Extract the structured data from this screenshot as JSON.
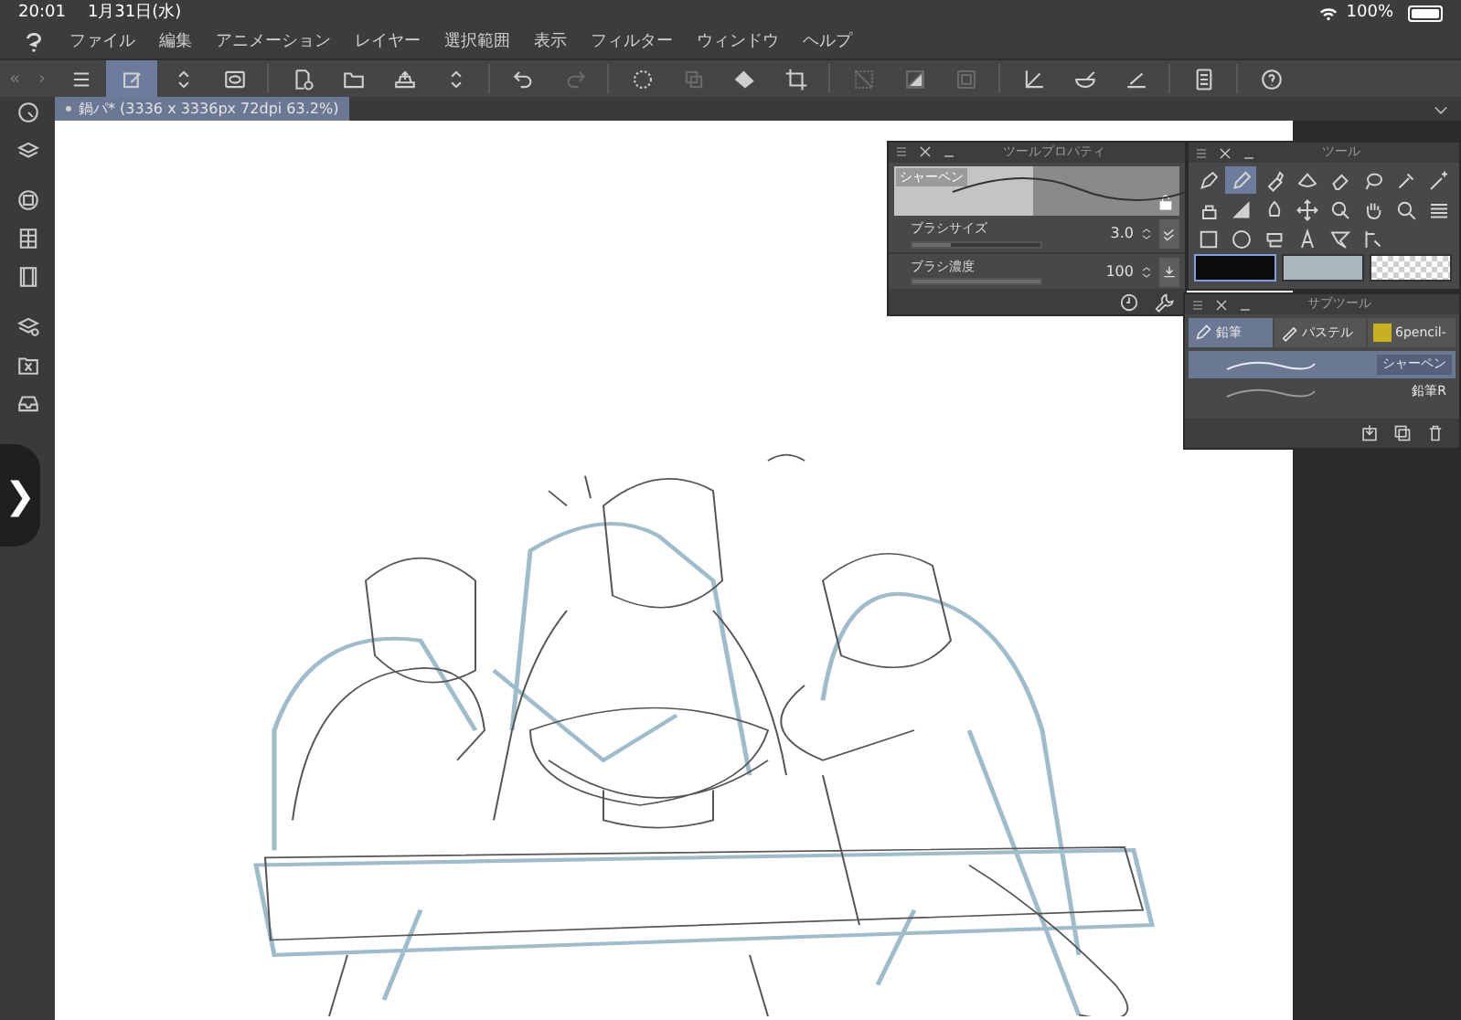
{
  "status_bar": {
    "time": "20:01",
    "date": "1月31日(水)",
    "battery": "100%"
  },
  "menu": {
    "items": [
      "ファイル",
      "編集",
      "アニメーション",
      "レイヤー",
      "選択範囲",
      "表示",
      "フィルター",
      "ウィンドウ",
      "ヘルプ"
    ]
  },
  "toolbar": {
    "nav": [
      "«",
      "›"
    ],
    "groups": [
      [
        {
          "selected": false,
          "disabled": false
        },
        {
          "selected": true,
          "disabled": false
        },
        {
          "selected": false,
          "disabled": false
        },
        {
          "selected": false,
          "disabled": false
        }
      ],
      [
        {
          "selected": false,
          "disabled": false
        },
        {
          "selected": false,
          "disabled": false
        },
        {
          "selected": false,
          "disabled": false
        },
        {
          "selected": false,
          "disabled": false
        }
      ],
      [
        {
          "selected": false,
          "disabled": false
        },
        {
          "selected": false,
          "disabled": true
        }
      ],
      [
        {
          "selected": false,
          "disabled": false
        },
        {
          "selected": false,
          "disabled": true
        },
        {
          "selected": false,
          "disabled": false
        },
        {
          "selected": false,
          "disabled": false
        }
      ],
      [
        {
          "selected": false,
          "disabled": true
        },
        {
          "selected": false,
          "disabled": true
        },
        {
          "selected": false,
          "disabled": true
        }
      ],
      [
        {
          "selected": false,
          "disabled": false
        },
        {
          "selected": false,
          "disabled": false
        },
        {
          "selected": false,
          "disabled": false
        }
      ],
      [
        {
          "selected": false,
          "disabled": false
        }
      ],
      [
        {
          "selected": false,
          "disabled": false
        }
      ]
    ]
  },
  "document_tab": {
    "title": "鍋パ* (3336 x 3336px 72dpi 63.2%)",
    "selected": true
  },
  "sidebar": {
    "handle": "❯"
  },
  "tool_property": {
    "title": "ツールプロパティ",
    "brush_name": "シャーペン",
    "rows": [
      {
        "label": "ブラシサイズ",
        "value": "3.0",
        "level": 0.3
      },
      {
        "label": "ブラシ濃度",
        "value": "100",
        "level": 1.0
      }
    ]
  },
  "tool_palette": {
    "title": "ツール",
    "tools": [
      {
        "selected": false
      },
      {
        "selected": true
      },
      {
        "selected": false
      },
      {
        "selected": false
      },
      {
        "selected": false
      },
      {
        "selected": false
      },
      {
        "selected": false
      },
      {
        "selected": false
      },
      {
        "selected": false
      },
      {
        "selected": false
      },
      {
        "selected": false
      },
      {
        "selected": false
      },
      {
        "selected": false
      },
      {
        "selected": false
      },
      {
        "selected": false
      },
      {
        "selected": false
      },
      {
        "selected": false
      },
      {
        "selected": false
      },
      {
        "selected": false
      },
      {
        "selected": false
      },
      {
        "selected": false
      },
      {
        "selected": false
      }
    ],
    "colors": [
      {
        "kind": "solid",
        "color": "#0c0c0e",
        "selected": true
      },
      {
        "kind": "solid",
        "color": "#a9b6bd",
        "selected": false
      },
      {
        "kind": "transparent",
        "selected": false
      }
    ]
  },
  "sub_tool": {
    "title": "サブツール",
    "tabs": [
      {
        "label": "鉛筆",
        "selected": true
      },
      {
        "label": "パステル",
        "selected": false
      },
      {
        "label": "6pencil-",
        "selected": false
      }
    ],
    "brushes": [
      {
        "name": "シャーペン",
        "selected": true
      },
      {
        "name": "鉛筆R",
        "selected": false
      }
    ]
  }
}
